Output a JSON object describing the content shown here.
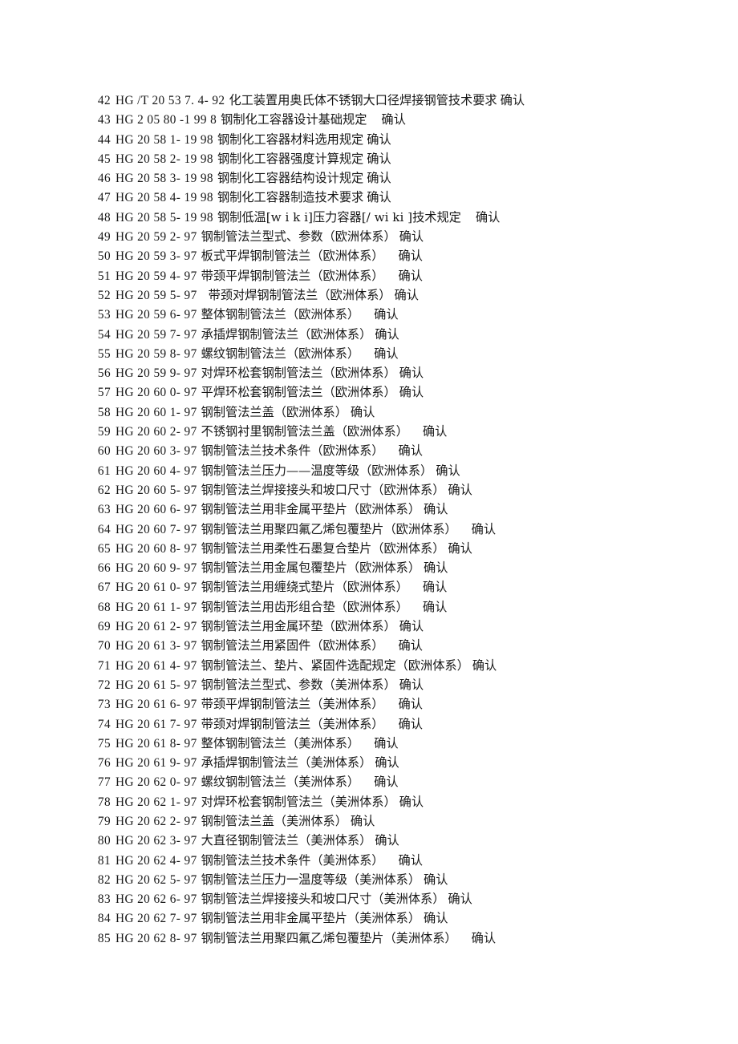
{
  "document": {
    "kind": "standards-reference-list",
    "page_background": "#ffffff",
    "text_color": "#171717",
    "rows": [
      {
        "index": "42",
        "code": "HG /T  20  53  7. 4- 92",
        "title": "化工装置用奥氏体不锈钢大口径焊接钢管技术要求",
        "status": "确认",
        "code_gap": false,
        "status_gap": false
      },
      {
        "index": "43",
        "code": "HG   2  05  80 -1  99  8",
        "title": "钢制化工容器设计基础规定",
        "status": "确认",
        "code_gap": true,
        "status_gap": true
      },
      {
        "index": "44",
        "code": "HG  20  58  1- 19  98",
        "title": "钢制化工容器材料选用规定",
        "status": "确认",
        "code_gap": false,
        "status_gap": false
      },
      {
        "index": "45",
        "code": "HG  20  58  2- 19  98",
        "title": "钢制化工容器强度计算规定",
        "status": "确认",
        "code_gap": false,
        "status_gap": false
      },
      {
        "index": "46",
        "code": "HG  20  58  3- 19  98",
        "title": "钢制化工容器结构设计规定",
        "status": "确认",
        "code_gap": false,
        "status_gap": false
      },
      {
        "index": "47",
        "code": "HG  20  58  4- 19  98",
        "title": "钢制化工容器制造技术要求",
        "status": "确认",
        "code_gap": false,
        "status_gap": false
      },
      {
        "index": "48",
        "code": "HG  20  58  5- 19  98",
        "title": "钢制低温[w i k i]压力容器[/ wi ki ]技术规定",
        "status": "确认",
        "code_gap": false,
        "status_gap": true
      },
      {
        "index": "49",
        "code": "HG  20  59  2- 97",
        "title": "钢制管法兰型式、参数（欧洲体系）",
        "status": "确认",
        "code_gap": false,
        "status_gap": false
      },
      {
        "index": "50",
        "code": "HG  20  59  3- 97",
        "title": "板式平焊钢制管法兰（欧洲体系）",
        "status": "确认",
        "code_gap": false,
        "status_gap": true
      },
      {
        "index": "51",
        "code": "HG  20  59  4- 97",
        "title": "带颈平焊钢制管法兰（欧洲体系）",
        "status": "确认",
        "code_gap": false,
        "status_gap": true
      },
      {
        "index": "52",
        "code": "HG  20  59  5- 97",
        "title": "带颈对焊钢制管法兰（欧洲体系）",
        "status": "确认",
        "code_gap": false,
        "status_gap": false,
        "title_gap": true
      },
      {
        "index": "53",
        "code": "HG  20  59  6- 97",
        "title": "整体钢制管法兰（欧洲体系）",
        "status": "确认",
        "code_gap": false,
        "status_gap": true
      },
      {
        "index": "54",
        "code": "HG  20  59  7- 97",
        "title": "承插焊钢制管法兰（欧洲体系）",
        "status": "确认",
        "code_gap": false,
        "status_gap": false
      },
      {
        "index": "55",
        "code": "HG  20  59  8- 97",
        "title": "螺纹钢制管法兰（欧洲体系）",
        "status": "确认",
        "code_gap": false,
        "status_gap": true
      },
      {
        "index": "56",
        "code": "HG  20  59  9- 97",
        "title": "对焊环松套钢制管法兰（欧洲体系）",
        "status": "确认",
        "code_gap": false,
        "status_gap": false
      },
      {
        "index": "57",
        "code": "HG  20  60  0- 97",
        "title": "平焊环松套钢制管法兰（欧洲体系）",
        "status": "确认",
        "code_gap": false,
        "status_gap": false
      },
      {
        "index": "58",
        "code": "HG  20  60  1- 97",
        "title": "钢制管法兰盖（欧洲体系）",
        "status": "确认",
        "code_gap": false,
        "status_gap": false
      },
      {
        "index": "59",
        "code": "HG  20  60  2- 97",
        "title": "不锈钢衬里钢制管法兰盖（欧洲体系）",
        "status": "确认",
        "code_gap": false,
        "status_gap": true
      },
      {
        "index": "60",
        "code": "HG  20  60  3- 97",
        "title": "钢制管法兰技术条件（欧洲体系）",
        "status": "确认",
        "code_gap": false,
        "status_gap": true
      },
      {
        "index": "61",
        "code": "HG  20  60  4- 97",
        "title": "钢制管法兰压力——温度等级（欧洲体系）",
        "status": "确认",
        "code_gap": false,
        "status_gap": false
      },
      {
        "index": "62",
        "code": "HG  20  60  5- 97",
        "title": "钢制管法兰焊接接头和坡口尺寸（欧洲体系）",
        "status": "确认",
        "code_gap": false,
        "status_gap": false
      },
      {
        "index": "63",
        "code": "HG  20  60  6- 97",
        "title": "钢制管法兰用非金属平垫片（欧洲体系）",
        "status": "确认",
        "code_gap": false,
        "status_gap": false
      },
      {
        "index": "64",
        "code": "HG  20  60  7- 97",
        "title": "钢制管法兰用聚四氟乙烯包覆垫片（欧洲体系）",
        "status": "确认",
        "code_gap": false,
        "status_gap": true
      },
      {
        "index": "65",
        "code": "HG  20  60  8- 97",
        "title": "钢制管法兰用柔性石墨复合垫片（欧洲体系）",
        "status": "确认",
        "code_gap": false,
        "status_gap": false
      },
      {
        "index": "66",
        "code": "HG  20  60  9- 97",
        "title": "钢制管法兰用金属包覆垫片（欧洲体系）",
        "status": "确认",
        "code_gap": false,
        "status_gap": false
      },
      {
        "index": "67",
        "code": "HG  20  61  0- 97",
        "title": "钢制管法兰用缠绕式垫片（欧洲体系）",
        "status": "确认",
        "code_gap": false,
        "status_gap": true
      },
      {
        "index": "68",
        "code": "HG  20  61  1- 97",
        "title": "钢制管法兰用齿形组合垫（欧洲体系）",
        "status": "确认",
        "code_gap": false,
        "status_gap": true
      },
      {
        "index": "69",
        "code": "HG  20  61  2- 97",
        "title": "钢制管法兰用金属环垫（欧洲体系）",
        "status": "确认",
        "code_gap": false,
        "status_gap": false
      },
      {
        "index": "70",
        "code": "HG  20  61  3- 97",
        "title": "钢制管法兰用紧固件（欧洲体系）",
        "status": "确认",
        "code_gap": false,
        "status_gap": true
      },
      {
        "index": "71",
        "code": "HG  20  61  4- 97",
        "title": "钢制管法兰、垫片、紧固件选配规定（欧洲体系）",
        "status": "确认",
        "code_gap": false,
        "status_gap": false
      },
      {
        "index": "72",
        "code": "HG  20  61  5- 97",
        "title": "钢制管法兰型式、参数（美洲体系）",
        "status": "确认",
        "code_gap": false,
        "status_gap": false
      },
      {
        "index": "73",
        "code": "HG  20  61  6- 97",
        "title": "带颈平焊钢制管法兰（美洲体系）",
        "status": "确认",
        "code_gap": false,
        "status_gap": true
      },
      {
        "index": "74",
        "code": "HG  20  61  7- 97",
        "title": "带颈对焊钢制管法兰（美洲体系）",
        "status": "确认",
        "code_gap": false,
        "status_gap": true
      },
      {
        "index": "75",
        "code": "HG  20  61  8- 97",
        "title": "整体钢制管法兰（美洲体系）",
        "status": "确认",
        "code_gap": false,
        "status_gap": true
      },
      {
        "index": "76",
        "code": "HG  20  61  9- 97",
        "title": "承插焊钢制管法兰（美洲体系）",
        "status": "确认",
        "code_gap": false,
        "status_gap": false
      },
      {
        "index": "77",
        "code": "HG  20  62  0- 97",
        "title": "螺纹钢制管法兰（美洲体系）",
        "status": "确认",
        "code_gap": false,
        "status_gap": true
      },
      {
        "index": "78",
        "code": "HG  20  62  1- 97",
        "title": "对焊环松套钢制管法兰（美洲体系）",
        "status": "确认",
        "code_gap": false,
        "status_gap": false
      },
      {
        "index": "79",
        "code": "HG  20  62  2- 97",
        "title": "钢制管法兰盖（美洲体系）",
        "status": "确认",
        "code_gap": false,
        "status_gap": false
      },
      {
        "index": "80",
        "code": "HG  20  62  3- 97",
        "title": "大直径钢制管法兰（美洲体系）",
        "status": "确认",
        "code_gap": false,
        "status_gap": false
      },
      {
        "index": "81",
        "code": "HG  20  62  4- 97",
        "title": "钢制管法兰技术条件（美洲体系）",
        "status": "确认",
        "code_gap": false,
        "status_gap": true
      },
      {
        "index": "82",
        "code": "HG  20  62  5- 97",
        "title": "钢制管法兰压力一温度等级（美洲体系）",
        "status": "确认",
        "code_gap": false,
        "status_gap": false
      },
      {
        "index": "83",
        "code": "HG  20  62  6- 97",
        "title": "钢制管法兰焊接接头和坡口尺寸（美洲体系）",
        "status": "确认",
        "code_gap": false,
        "status_gap": false
      },
      {
        "index": "84",
        "code": "HG  20  62  7- 97",
        "title": "钢制管法兰用非金属平垫片（美洲体系）",
        "status": "确认",
        "code_gap": false,
        "status_gap": false
      },
      {
        "index": "85",
        "code": "HG  20  62  8- 97",
        "title": "钢制管法兰用聚四氟乙烯包覆垫片（美洲体系）",
        "status": "确认",
        "code_gap": false,
        "status_gap": true
      }
    ]
  }
}
